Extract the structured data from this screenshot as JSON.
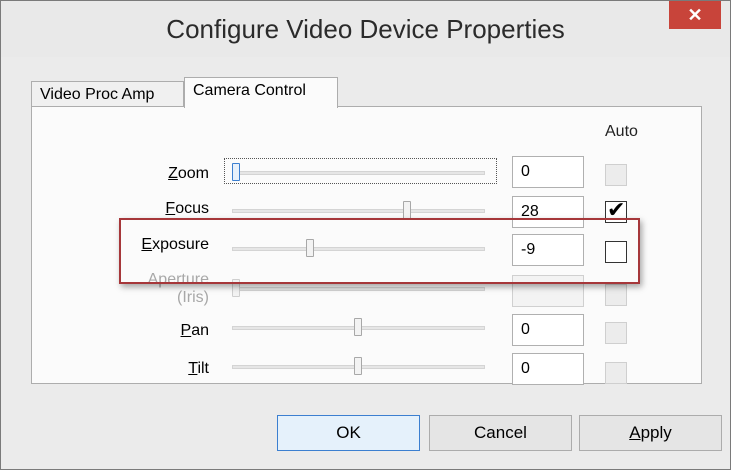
{
  "window": {
    "title": "Configure Video Device Properties",
    "close_glyph": "✕"
  },
  "tabs": [
    {
      "label": "Video Proc Amp"
    },
    {
      "label": "Camera Control"
    }
  ],
  "auto_header": "Auto",
  "rows": [
    {
      "label_key": "Z",
      "label_rest": "oom",
      "value": "0",
      "slider_position": 0.0,
      "auto_checked": false,
      "enabled": true,
      "auto_enabled": false
    },
    {
      "label_key": "F",
      "label_rest": "ocus",
      "value": "28",
      "slider_position": 0.69,
      "auto_checked": true,
      "enabled": true,
      "auto_enabled": true
    },
    {
      "label_key": "E",
      "label_rest": "xposure",
      "value": "-9",
      "slider_position": 0.31,
      "auto_checked": false,
      "enabled": true,
      "auto_enabled": true
    },
    {
      "label_line1": "Aperture",
      "label_line2": "(Iris)",
      "value": "",
      "slider_position": 0.0,
      "auto_checked": false,
      "enabled": false,
      "auto_enabled": false
    },
    {
      "label_key": "P",
      "label_rest": "an",
      "value": "0",
      "slider_position": 0.5,
      "auto_checked": false,
      "enabled": true,
      "auto_enabled": false
    },
    {
      "label_key": "T",
      "label_rest": "ilt",
      "value": "0",
      "slider_position": 0.5,
      "auto_checked": false,
      "enabled": true,
      "auto_enabled": false
    }
  ],
  "buttons": {
    "ok": "OK",
    "cancel": "Cancel",
    "apply_key": "A",
    "apply_rest": "pply"
  },
  "colors": {
    "highlight": "#a6373a",
    "close": "#c8443a",
    "focus": "#3c7fd0"
  }
}
